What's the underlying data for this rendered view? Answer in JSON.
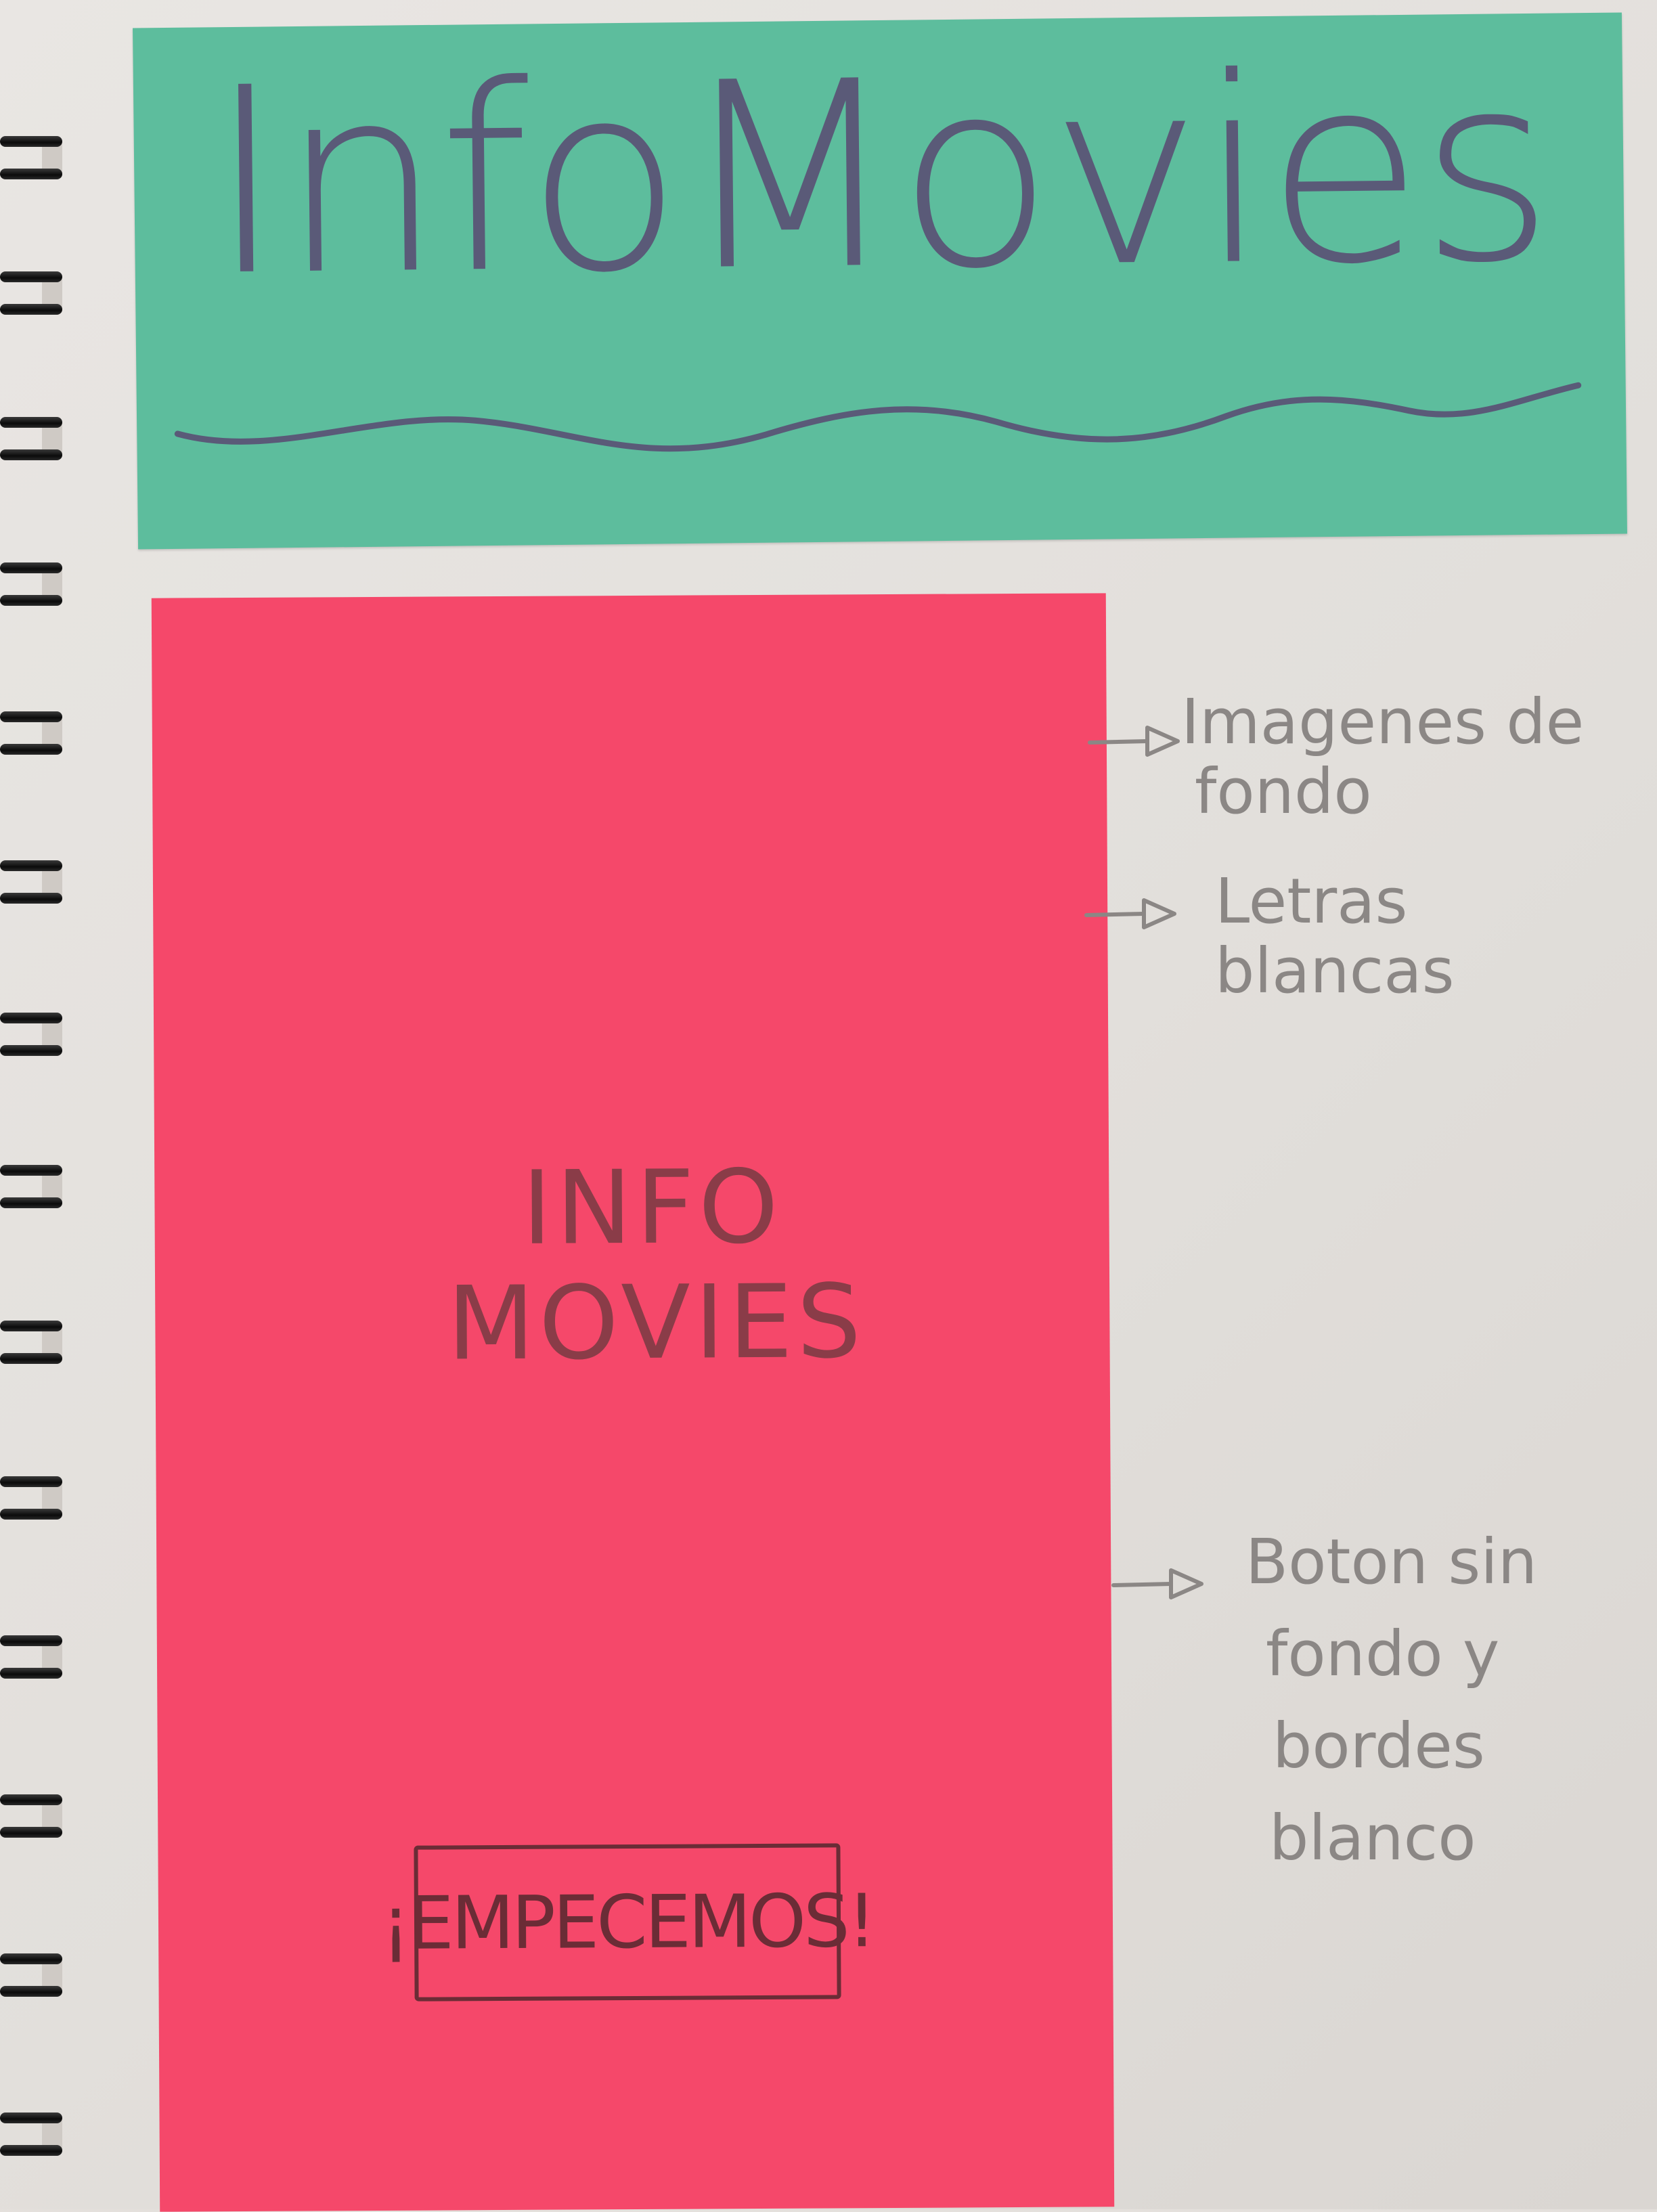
{
  "sketch": {
    "header": {
      "title": "InfoMovies"
    },
    "screen": {
      "title_line1": "INFO",
      "title_line2": "MOVIES",
      "button_label": "¡EMPECEMOS!",
      "background_color": "#f5486a"
    },
    "header_color": "#5dbd9d",
    "annotations": [
      {
        "line1": "Imagenes de",
        "line2": "fondo"
      },
      {
        "line1": "Letras blancas"
      },
      {
        "line1": "Boton sin",
        "line2": "fondo y",
        "line3": "bordes",
        "line4": "blanco"
      }
    ]
  }
}
